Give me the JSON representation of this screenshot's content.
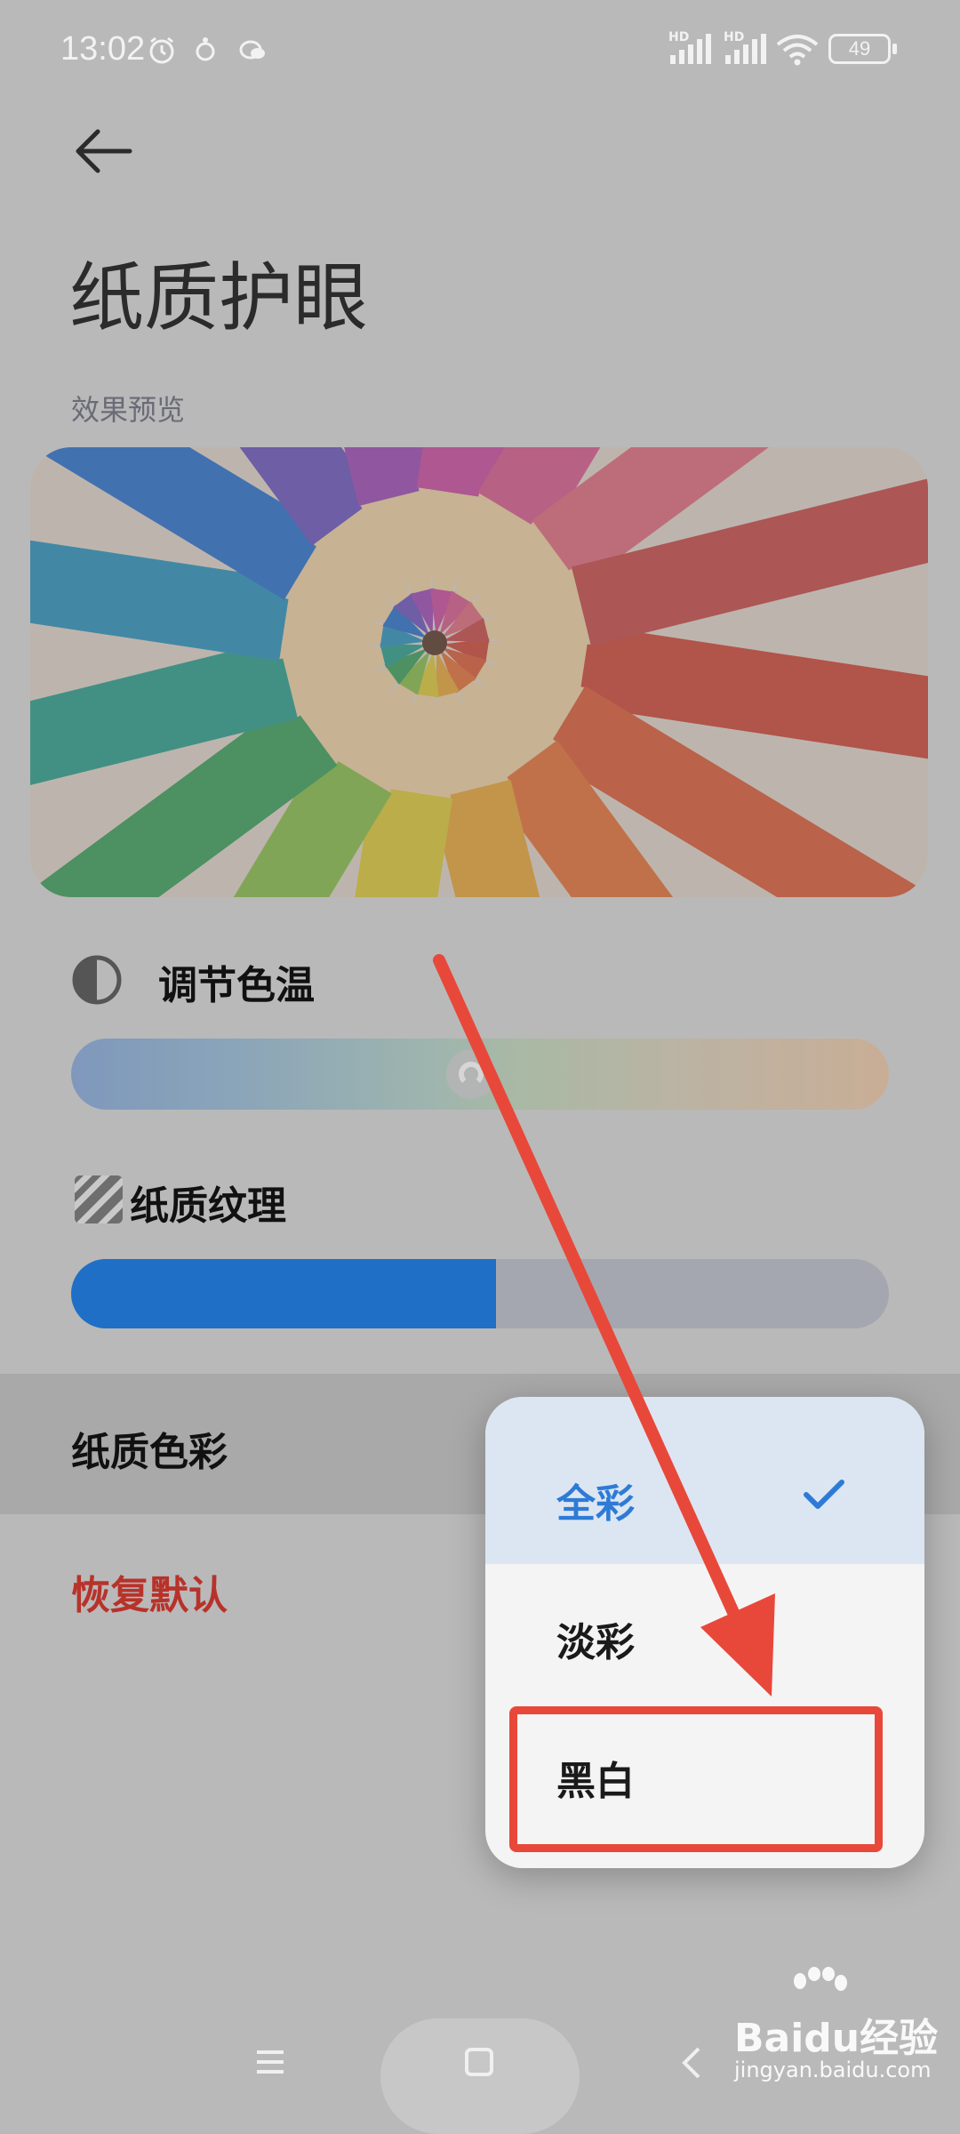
{
  "status_bar": {
    "time": "13:02",
    "battery": "49",
    "network_1": "HD",
    "network_2": "HD"
  },
  "page": {
    "title": "纸质护眼",
    "preview_label": "效果预览"
  },
  "color_temperature": {
    "label": "调节色温",
    "level_fraction": 0.49
  },
  "paper_texture": {
    "label": "纸质纹理",
    "level_fraction": 0.52
  },
  "paper_color": {
    "label": "纸质色彩"
  },
  "reset": {
    "label": "恢复默认"
  },
  "popup": {
    "options": [
      {
        "label": "全彩",
        "selected": true
      },
      {
        "label": "淡彩",
        "selected": false
      },
      {
        "label": "黑白",
        "selected": false
      }
    ]
  },
  "watermark": {
    "brand": "Baidu经验",
    "url": "jingyan.baidu.com"
  },
  "colors": {
    "accent": "#2e7bd6",
    "reset_red": "#b8322a",
    "annotation_red": "#e8483a",
    "texture_fill": "#1f6fc6"
  }
}
